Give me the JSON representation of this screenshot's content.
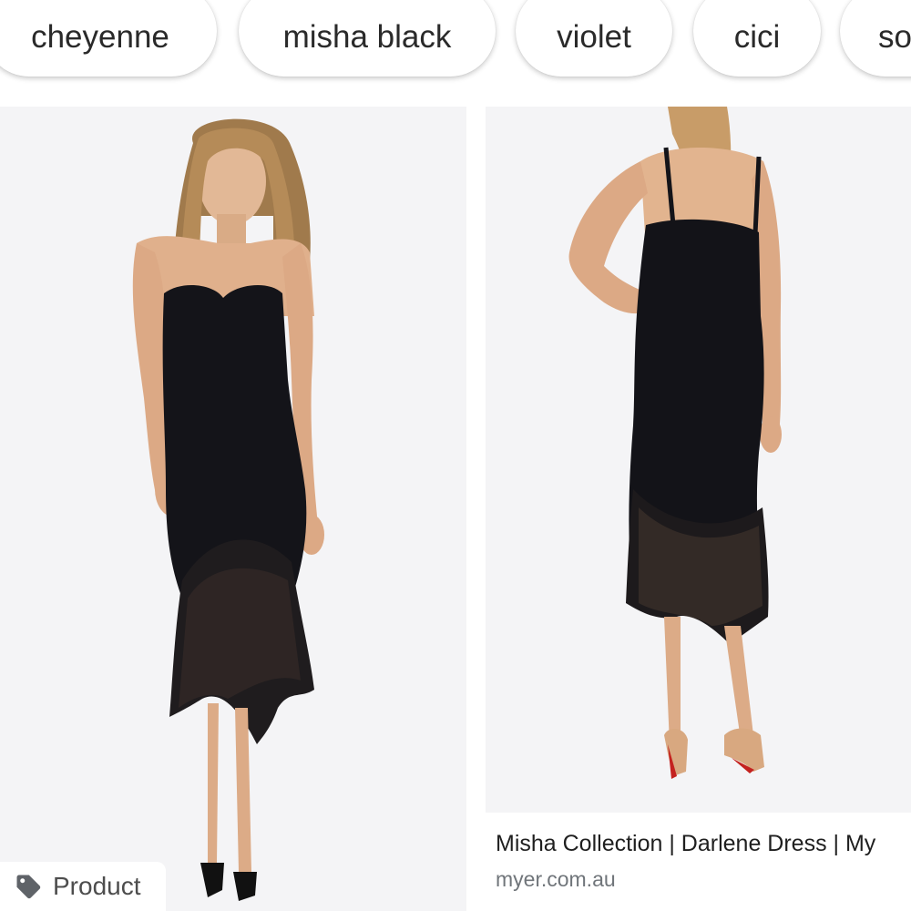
{
  "chips": [
    {
      "label": "cheyenne"
    },
    {
      "label": "misha black"
    },
    {
      "label": "violet"
    },
    {
      "label": "cici"
    },
    {
      "label": "so"
    }
  ],
  "results": [
    {
      "image": "woman-strapless-black-lace-dress",
      "badge": {
        "icon": "tag-icon",
        "label": "Product"
      }
    },
    {
      "image": "back-view-black-lace-dress",
      "title": "Misha Collection | Darlene Dress | My",
      "source": "myer.com.au"
    }
  ],
  "colors": {
    "image_background": "#f4f4f6",
    "chip_text": "#2a2a2a",
    "caption_source": "#70757a",
    "dress": "#121218"
  }
}
